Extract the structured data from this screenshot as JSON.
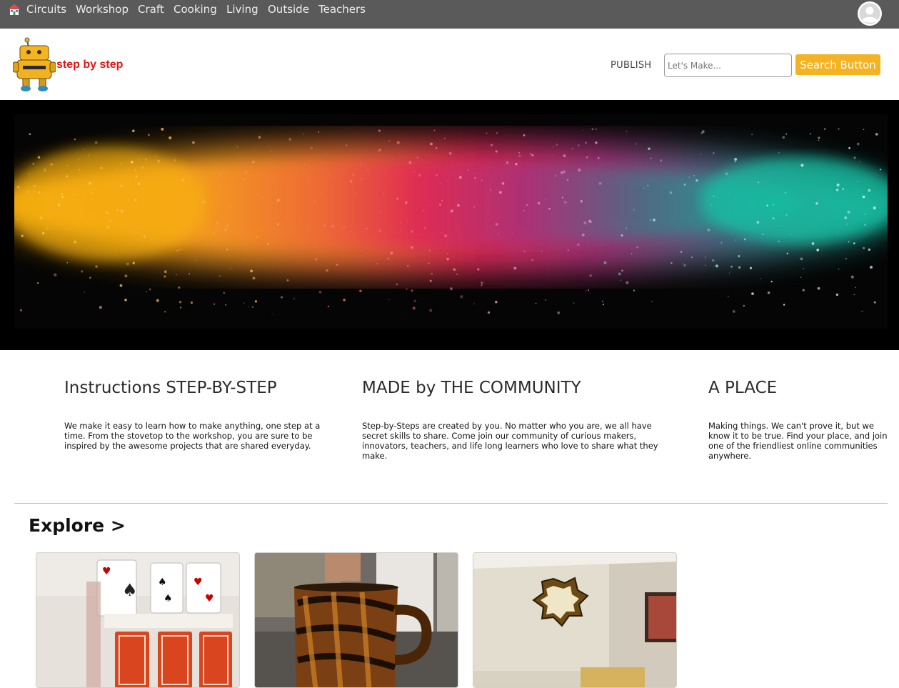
{
  "nav": {
    "links": [
      "Circuits",
      "Workshop",
      "Craft",
      "Cooking",
      "Living",
      "Outside",
      "Teachers"
    ]
  },
  "header": {
    "logo_text": "step by step",
    "publish_label": "PUBLISH",
    "search_placeholder": "Let's Make...",
    "search_button_label": "Search Button"
  },
  "features": [
    {
      "title": "Instructions STEP-BY-STEP",
      "text": "We make it easy to learn how to make anything, one step at a time. From the stovetop to the workshop, you are sure to be inspired by the awesome projects that are shared everyday."
    },
    {
      "title": "MADE by THE COMMUNITY",
      "text": "Step-by-Steps are created by you. No matter who you are, we all have secret skills to share. Come join our community of curious makers, innovators, teachers, and life long learners who love to share what they make."
    },
    {
      "title": "A PLACE",
      "text": "Making things. We can't prove it, but we know it to be true. Find your place, and join one of the friendliest online communities anywhere."
    }
  ],
  "explore": {
    "heading": "Explore >"
  },
  "colors": {
    "nav_bg": "#5a5a5a",
    "accent": "#f4b322",
    "logo_red": "#e01515"
  },
  "icons": [
    "home-icon",
    "user-avatar-icon",
    "robot-logo"
  ]
}
